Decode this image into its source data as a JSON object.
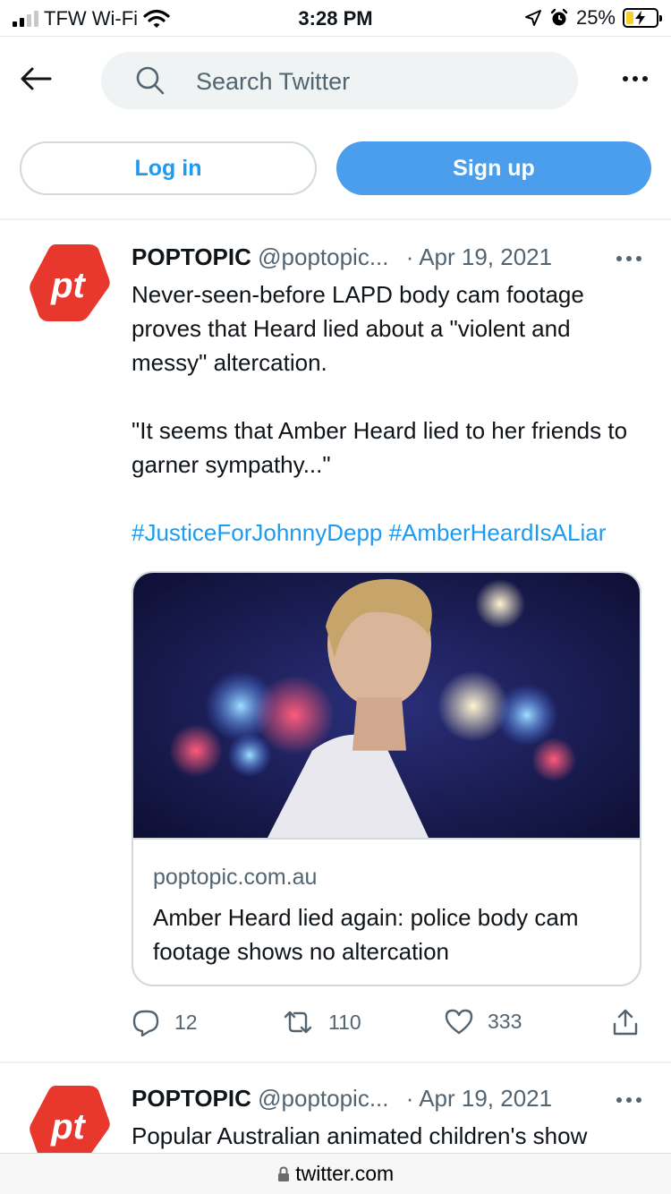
{
  "status_bar": {
    "carrier": "TFW Wi-Fi",
    "time": "3:28 PM",
    "battery_percent": "25%",
    "battery_level": 0.25,
    "signal_bars": 2,
    "icons": [
      "signal-icon",
      "wifi-icon",
      "location-arrow-icon",
      "alarm-icon",
      "battery-charging-icon"
    ]
  },
  "search": {
    "placeholder": "Search Twitter"
  },
  "auth": {
    "login_label": "Log in",
    "signup_label": "Sign up"
  },
  "colors": {
    "accent": "#1d9bf0",
    "signup_bg": "#4a9eeb",
    "secondary_text": "#536471",
    "brand_red": "#e8372c"
  },
  "tweets": [
    {
      "avatar_text": "pt",
      "name": "POPTOPIC",
      "handle": "@poptopic...",
      "separator": "·",
      "date": "Apr 19, 2021",
      "text_p1": "Never-seen-before LAPD body cam footage proves that Heard lied about a \"violent and messy\" altercation.",
      "text_p2": "\"It seems that Amber Heard lied to her friends to garner sympathy...\"",
      "hashtags": "#JusticeForJohnnyDepp #AmberHeardIsALiar",
      "card": {
        "domain": "poptopic.com.au",
        "title": "Amber Heard lied again: police body cam footage shows no altercation"
      },
      "stats": {
        "replies": "12",
        "retweets": "110",
        "likes": "333"
      }
    },
    {
      "avatar_text": "pt",
      "name": "POPTOPIC",
      "handle": "@poptopic...",
      "separator": "·",
      "date": "Apr 19, 2021",
      "text_p1": "Popular Australian animated children's show"
    }
  ],
  "browser": {
    "url": "twitter.com"
  }
}
